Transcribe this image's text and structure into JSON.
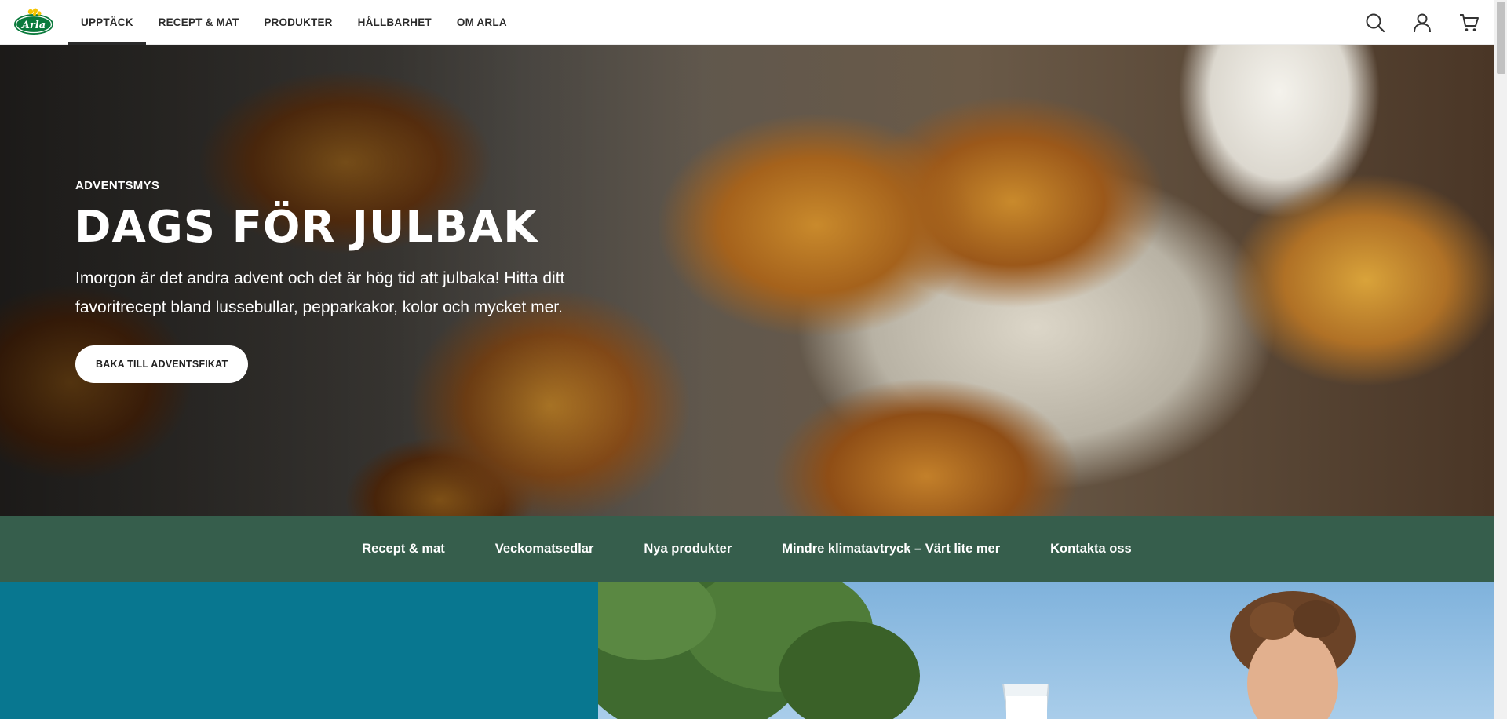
{
  "header": {
    "logo_text": "Arla",
    "nav": [
      {
        "label": "UPPTÄCK",
        "active": true
      },
      {
        "label": "RECEPT & MAT",
        "active": false
      },
      {
        "label": "PRODUKTER",
        "active": false
      },
      {
        "label": "HÅLLBARHET",
        "active": false
      },
      {
        "label": "OM ARLA",
        "active": false
      }
    ],
    "icons": [
      "search-icon",
      "user-icon",
      "cart-icon"
    ]
  },
  "hero": {
    "eyebrow": "ADVENTSMYS",
    "title": "DAGS FÖR JULBAK",
    "description": "Imorgon är det andra advent och det är hög tid att julbaka! Hitta ditt favoritrecept bland lussebullar, pepparkakor, kolor och mycket mer.",
    "cta_label": "BAKA TILL ADVENTSFIKAT"
  },
  "quicklinks": [
    {
      "label": "Recept & mat"
    },
    {
      "label": "Veckomatsedlar"
    },
    {
      "label": "Nya produkter"
    },
    {
      "label": "Mindre klimatavtryck – Värt lite mer"
    },
    {
      "label": "Kontakta oss"
    }
  ],
  "colors": {
    "brand_green": "#0a7a3c",
    "quickbar_bg": "#365e4c",
    "teal_panel": "#087790"
  }
}
